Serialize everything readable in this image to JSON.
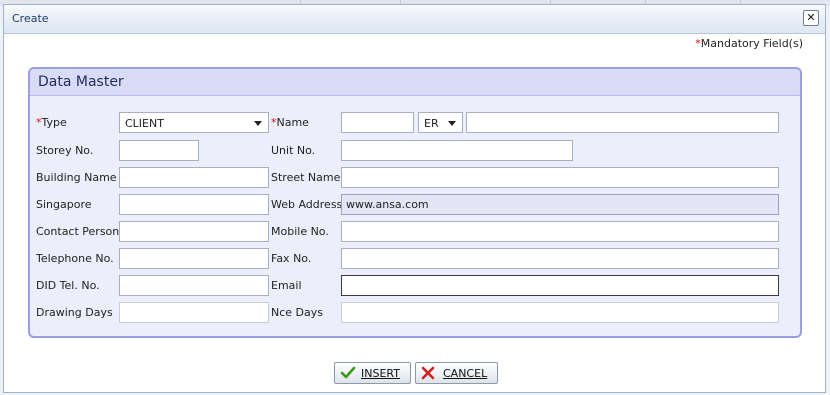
{
  "dialog": {
    "title": "Create"
  },
  "mandatory": {
    "star": "*",
    "text": "Mandatory Field(s)"
  },
  "panel": {
    "title": "Data Master"
  },
  "fields": {
    "type": {
      "label": "Type",
      "value": "CLIENT"
    },
    "name": {
      "label": "Name",
      "prefix": "ER",
      "first": "",
      "rest": ""
    },
    "storey": {
      "label": "Storey No.",
      "value": ""
    },
    "unit": {
      "label": "Unit No.",
      "value": ""
    },
    "building": {
      "label": "Building Name",
      "value": ""
    },
    "street": {
      "label": "Street Name",
      "value": ""
    },
    "singapore": {
      "label": "Singapore",
      "value": ""
    },
    "web": {
      "label": "Web Address",
      "value": "www.ansa.com"
    },
    "contact": {
      "label": "Contact Person",
      "value": ""
    },
    "mobile": {
      "label": "Mobile No.",
      "value": ""
    },
    "telephone": {
      "label": "Telephone No.",
      "value": ""
    },
    "fax": {
      "label": "Fax No.",
      "value": ""
    },
    "did": {
      "label": "DID Tel. No.",
      "value": ""
    },
    "email": {
      "label": "Email",
      "value": ""
    },
    "drawing": {
      "label": "Drawing Days",
      "value": ""
    },
    "nce": {
      "label": "Nce Days",
      "value": ""
    }
  },
  "buttons": {
    "insert": "INSERT",
    "cancel": "CANCEL"
  },
  "colors": {
    "accent": "#9c9ee0",
    "required_star": "#d01010",
    "check": "#3a9a1e",
    "cancel_x": "#d21f1f"
  },
  "icons": {
    "close": "close-icon",
    "insert": "check-icon",
    "cancel": "cross-icon",
    "dropdown": "chevron-down-icon"
  }
}
